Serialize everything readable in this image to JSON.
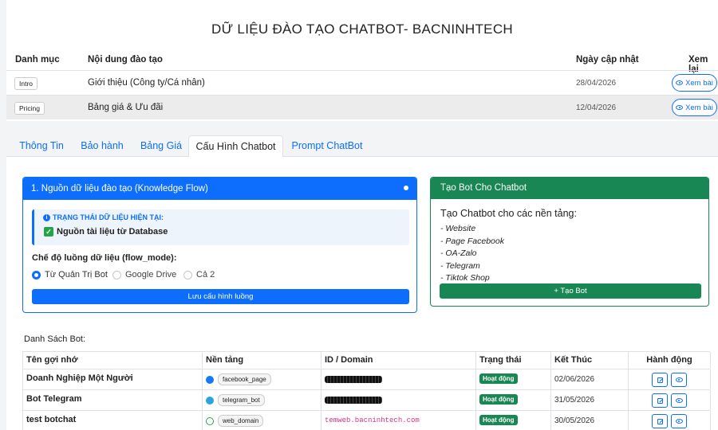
{
  "page_title": "DỮ LIỆU ĐÀO TẠO CHATBOT- BACNINHTECH",
  "training_table": {
    "headers": [
      "Danh mục",
      "Nội dung đào tạo",
      "Ngày cập nhật",
      "Xem lại"
    ],
    "rows": [
      {
        "category": "Intro",
        "content": "Giới thiệu (Công ty/Cá nhân)",
        "date": "28/04/2026",
        "action": "Xem bài"
      },
      {
        "category": "Pricing",
        "content": "Bảng giá & Ưu đãi",
        "date": "12/04/2026",
        "action": "Xem bài"
      }
    ]
  },
  "tabs": [
    "Thông Tin",
    "Bảo hành",
    "Bảng Giá",
    "Cấu Hình Chatbot",
    "Prompt ChatBot"
  ],
  "active_tab": "Cấu Hình Chatbot",
  "knowledge_flow": {
    "title": "1. Nguồn dữ liệu đào tạo (Knowledge Flow)",
    "status_title": "TRẠNG THÁI DỮ LIỆU HIỆN TẠI:",
    "status_value": "Nguồn tài liệu từ Database",
    "flow_mode_label": "Chế độ luồng dữ liệu (flow_mode):",
    "options": [
      "Từ Quản Trị Bot",
      "Google Drive",
      "Cả 2"
    ],
    "selected_option": "Từ Quản Trị Bot",
    "save_label": "Lưu cấu hình luồng"
  },
  "bot_create": {
    "title": "Tạo Bot Cho Chatbot",
    "intro": "Tạo Chatbot cho các nền tảng:",
    "platforms": [
      "- Website",
      "- Page Facebook",
      "- OA-Zalo",
      "- Telegram",
      "- Tiktok Shop"
    ],
    "button_label": "+ Tạo Bot"
  },
  "bot_list": {
    "title": "Danh Sách Bot:",
    "headers": [
      "Tên gợi nhớ",
      "Nền tảng",
      "ID / Domain",
      "Trạng thái",
      "Kết Thúc",
      "Hành động"
    ],
    "rows": [
      {
        "name": "Doanh Nghiệp Một Người",
        "platform": "facebook_page",
        "platform_icon": "facebook-icon",
        "id": "",
        "status": "Hoạt động",
        "end": "02/06/2026"
      },
      {
        "name": "Bot Telegram",
        "platform": "telegram_bot",
        "platform_icon": "telegram-icon",
        "id": "",
        "status": "Hoạt động",
        "end": "31/05/2026"
      },
      {
        "name": "test botchat",
        "platform": "web_domain",
        "platform_icon": "globe-icon",
        "id": "temweb.bacninhtech.com",
        "status": "Hoạt động",
        "end": "30/05/2026"
      }
    ]
  },
  "colors": {
    "primary": "#0d6efd",
    "success": "#198754",
    "code": "#d63384"
  }
}
